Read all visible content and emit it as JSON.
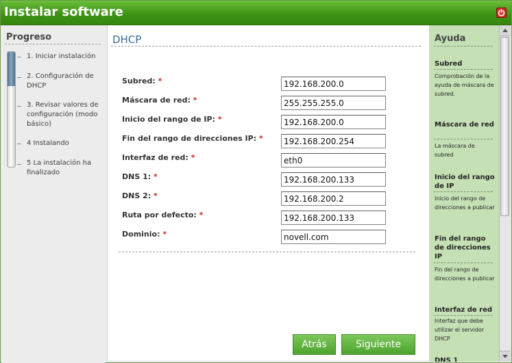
{
  "window": {
    "title": "Instalar software",
    "accent_color": "#3f9216"
  },
  "progress": {
    "title": "Progreso",
    "fill_fraction": 0.3,
    "steps": [
      {
        "label": "1. Iniciar instalación"
      },
      {
        "label": "2. Configuración de DHCP"
      },
      {
        "label": "3. Revisar valores de configuración (modo básico)"
      },
      {
        "label": "4 Instalando"
      },
      {
        "label": "5 La instalación ha finalizado"
      }
    ]
  },
  "main": {
    "title": "DHCP",
    "required_marker": "*",
    "fields": [
      {
        "label": "Subred:",
        "value": "192.168.200.0"
      },
      {
        "label": "Máscara de red:",
        "value": "255.255.255.0"
      },
      {
        "label": "Inicio del rango de IP:",
        "value": "192.168.200.0"
      },
      {
        "label": "Fin del rango de direcciones IP:",
        "value": "192.168.200.254"
      },
      {
        "label": "Interfaz de red:",
        "value": "eth0"
      },
      {
        "label": "DNS 1:",
        "value": "192.168.200.133"
      },
      {
        "label": "DNS 2:",
        "value": "192.168.200.2"
      },
      {
        "label": "Ruta por defecto:",
        "value": "192.168.200.133"
      },
      {
        "label": "Dominio:",
        "value": "novell.com"
      }
    ],
    "back_label": "Atrás",
    "next_label": "Siguiente"
  },
  "help": {
    "title": "Ayuda",
    "sections": [
      {
        "heading": "Subred",
        "text": "Comprobación de la ayuda de máscara de subred."
      },
      {
        "heading": "Máscara de red",
        "text": "La máscara de subred"
      },
      {
        "heading": "Inicio del rango de IP",
        "text": "Inicio del rango de direcciones a publicar"
      },
      {
        "heading": "Fin del rango de direcciones IP",
        "text": "Fin del rango de direcciones a publicar"
      },
      {
        "heading": "Interfaz de red",
        "text": "Interfaz que debe utilizar el servidor DHCP"
      },
      {
        "heading": "DNS 1",
        "text": ""
      }
    ]
  }
}
